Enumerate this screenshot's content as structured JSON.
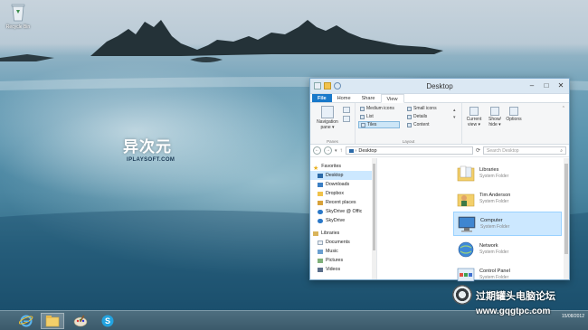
{
  "desktop": {
    "recycle_bin_label": "Recycle Bin",
    "logo": {
      "cn": "异次元",
      "en": "IPLAYSOFT.COM"
    }
  },
  "window": {
    "title": "Desktop",
    "controls": [
      "–",
      "□",
      "✕"
    ],
    "tabs": [
      "File",
      "Home",
      "Share",
      "View"
    ],
    "active_tab": "View",
    "ribbon": {
      "panes_group": "Panes",
      "layout_group": "Layout",
      "navigation_pane": "Navigation pane ▾",
      "layout_items": [
        "Medium icons",
        "Small icons",
        "List",
        "Details",
        "Tiles",
        "Content"
      ],
      "current_view": "Current view ▾",
      "show_hide": "Show/ hide ▾",
      "options": "Options"
    },
    "address": {
      "path": "Desktop",
      "search_placeholder": "Search Desktop"
    },
    "nav_pane": {
      "favorites_header": "Favorites",
      "favorites": [
        "Desktop",
        "Downloads",
        "Dropbox",
        "Recent places",
        "SkyDrive @ Offic",
        "SkyDrive"
      ],
      "libraries_header": "Libraries",
      "libraries": [
        "Documents",
        "Music",
        "Pictures",
        "Videos"
      ]
    },
    "items": [
      {
        "name": "Libraries",
        "type": "System Folder"
      },
      {
        "name": "Tim Anderson",
        "type": "System Folder"
      },
      {
        "name": "Computer",
        "type": "System Folder"
      },
      {
        "name": "Network",
        "type": "System Folder"
      },
      {
        "name": "Control Panel",
        "type": "System Folder"
      }
    ]
  },
  "taskbar": {
    "tray_time": "",
    "tray_date": "15/08/2012"
  },
  "watermark": {
    "cn": "过期罐头电脑论坛",
    "url": "www.gqgtpc.com"
  },
  "colors": {
    "accent": "#1979ca",
    "selection": "#cce8ff",
    "taskbar": "#3b5a6b"
  }
}
